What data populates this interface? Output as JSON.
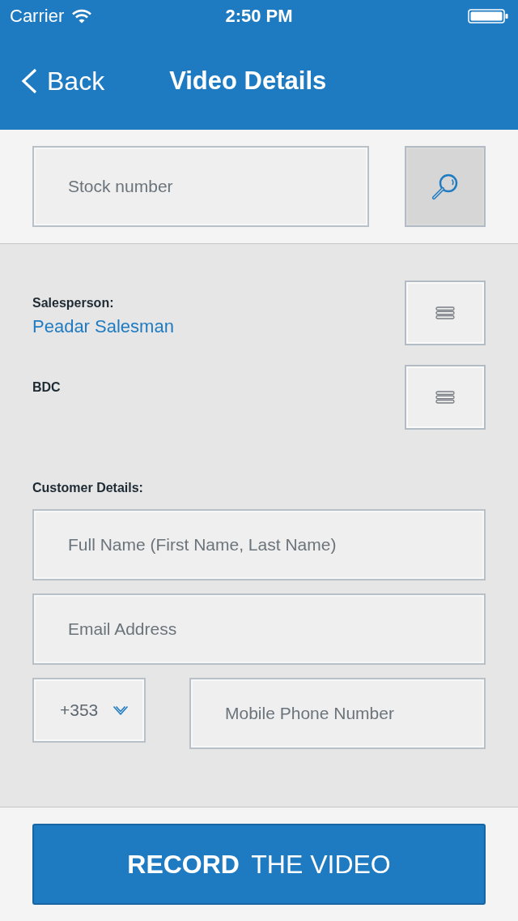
{
  "status_bar": {
    "carrier": "Carrier",
    "time": "2:50 PM"
  },
  "nav_bar": {
    "back_label": "Back",
    "title": "Video Details"
  },
  "search": {
    "placeholder": "Stock number"
  },
  "assignments": [
    {
      "label": "Salesperson:",
      "value": "Peadar Salesman"
    },
    {
      "label": "BDC"
    }
  ],
  "customer_details": {
    "heading": "Customer Details:",
    "fields": [
      {
        "placeholder": "Full Name (First Name, Last Name)"
      },
      {
        "placeholder": "Email Address"
      }
    ],
    "phone": {
      "country_code": "+353",
      "placeholder": "Mobile Phone Number"
    }
  },
  "record_button": "**RECORD** THE VIDEO"
}
